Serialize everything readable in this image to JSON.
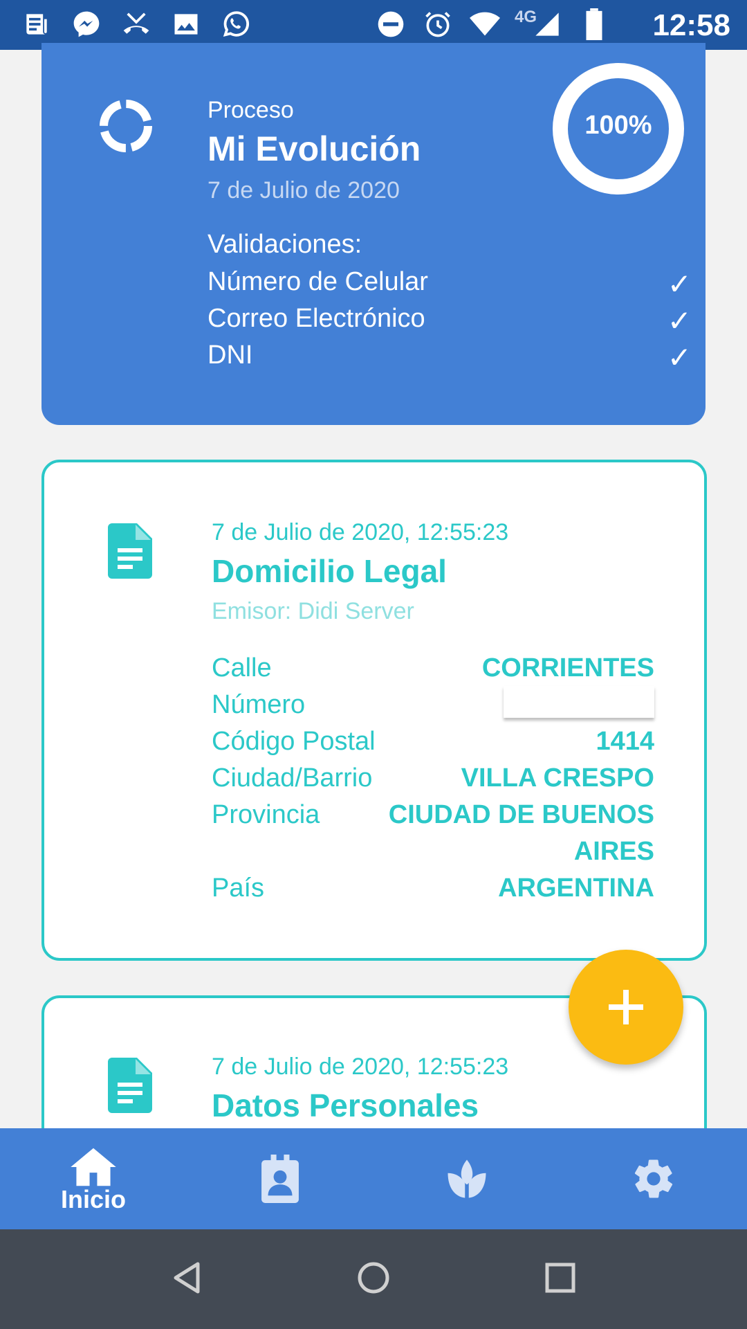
{
  "status_bar": {
    "time": "12:58",
    "network": "4G",
    "left_icons": [
      "news-icon",
      "messenger-icon",
      "missed-call-icon",
      "image-icon",
      "whatsapp-icon"
    ],
    "right_icons": [
      "dnd-icon",
      "alarm-icon",
      "wifi-icon",
      "signal-icon",
      "battery-icon"
    ]
  },
  "process_card": {
    "label": "Proceso",
    "title": "Mi Evolución",
    "date": "7 de Julio de 2020",
    "progress_percent": 100,
    "progress_text": "100%",
    "validations_title": "Validaciones:",
    "validations": [
      {
        "label": "Número de Celular",
        "check": "✓"
      },
      {
        "label": "Correo Electrónico",
        "check": "✓"
      },
      {
        "label": "DNI",
        "check": "✓"
      }
    ]
  },
  "credential_card_1": {
    "date": "7 de Julio de 2020, 12:55:23",
    "title": "Domicilio Legal",
    "emitter": "Emisor: Didi Server",
    "fields": [
      {
        "label": "Calle",
        "value": "CORRIENTES"
      },
      {
        "label": "Número",
        "value": ""
      },
      {
        "label": "Código Postal",
        "value": "1414"
      },
      {
        "label": "Ciudad/Barrio",
        "value": "VILLA CRESPO"
      },
      {
        "label": "Provincia",
        "value": "CIUDAD DE BUENOS"
      },
      {
        "label": "",
        "value": "AIRES"
      },
      {
        "label": "País",
        "value": "ARGENTINA"
      }
    ]
  },
  "credential_card_2": {
    "date": "7 de Julio de 2020, 12:55:23",
    "title": "Datos Personales"
  },
  "bottom_nav": {
    "items": [
      {
        "label": "Inicio",
        "icon": "home-icon",
        "active": true
      },
      {
        "label": "",
        "icon": "badge-icon",
        "active": false
      },
      {
        "label": "",
        "icon": "lotus-icon",
        "active": false
      },
      {
        "label": "",
        "icon": "gear-icon",
        "active": false
      }
    ]
  },
  "colors": {
    "primary": "#4380d6",
    "status_bar": "#1f56a0",
    "teal": "#2bc8c8",
    "fab": "#fbbb12"
  }
}
